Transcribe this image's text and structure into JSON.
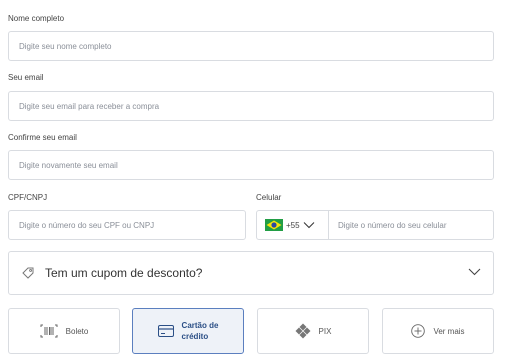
{
  "form": {
    "name": {
      "label": "Nome completo",
      "placeholder": "Digite seu nome completo"
    },
    "email": {
      "label": "Seu email",
      "placeholder": "Digite seu email para receber a compra"
    },
    "confirm_email": {
      "label": "Confirme seu email",
      "placeholder": "Digite novamente seu email"
    },
    "cpf": {
      "label": "CPF/CNPJ",
      "placeholder": "Digite o número do seu CPF ou CNPJ"
    },
    "phone": {
      "label": "Celular",
      "country_code": "+55",
      "placeholder": "Digite o número do seu celular",
      "flag_icon": "brazil-flag-icon"
    }
  },
  "coupon": {
    "label": "Tem um cupom de desconto?",
    "icon": "tag-icon"
  },
  "payment_methods": [
    {
      "label": "Boleto",
      "icon": "barcode-icon",
      "selected": false
    },
    {
      "label_line1": "Cartão de",
      "label_line2": "crédito",
      "icon": "credit-card-icon",
      "selected": true
    },
    {
      "label": "PIX",
      "icon": "pix-icon",
      "selected": false
    },
    {
      "label": "Ver mais",
      "icon": "plus-circle-icon",
      "selected": false
    }
  ],
  "colors": {
    "selected_border": "#5b7fbf",
    "selected_bg": "#eef2f8",
    "border": "#d9dce1"
  }
}
